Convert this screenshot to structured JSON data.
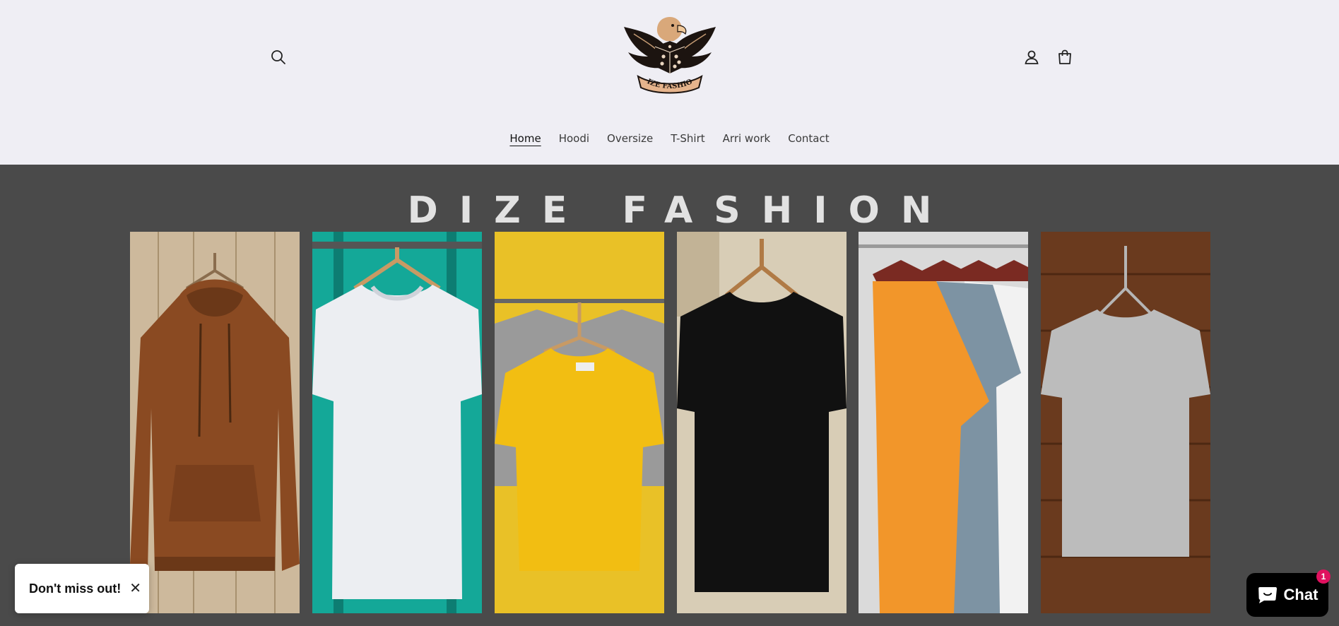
{
  "header": {
    "logo_text": "DIZE FASHION",
    "search_icon": "search-icon",
    "account_icon": "user-icon",
    "cart_icon": "bag-icon"
  },
  "nav": {
    "items": [
      {
        "label": "Home",
        "active": true
      },
      {
        "label": "Hoodi"
      },
      {
        "label": "Oversize"
      },
      {
        "label": "T-Shirt"
      },
      {
        "label": "Arri work"
      },
      {
        "label": "Contact"
      }
    ]
  },
  "hero": {
    "title": "DIZE FASHION",
    "background_color": "#4a4a4a",
    "panels": [
      {
        "name": "brown-hoodie",
        "garment_color": "#8a4a22",
        "backdrop_color": "#cdb99c"
      },
      {
        "name": "white-tshirt",
        "garment_color": "#eceef2",
        "backdrop_color": "#14a898"
      },
      {
        "name": "yellow-tshirt",
        "garment_color": "#f2be12",
        "backdrop_color": "#e9c127"
      },
      {
        "name": "black-tshirt",
        "garment_color": "#111111",
        "backdrop_color": "#d8cdb6"
      },
      {
        "name": "assorted-tshirts",
        "garment_color": "#f2962a",
        "backdrop_color": "#dadada"
      },
      {
        "name": "grey-tshirt",
        "garment_color": "#bcbcbc",
        "backdrop_color": "#6a3a1e"
      }
    ]
  },
  "popup": {
    "text": "Don't miss out!",
    "close_symbol": "✕"
  },
  "chat": {
    "label": "Chat",
    "badge_count": "1",
    "icon": "chat-bubble-icon"
  }
}
